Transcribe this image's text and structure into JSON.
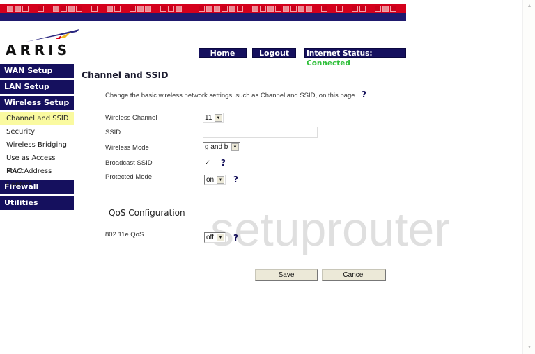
{
  "brand": {
    "logo_text": "ARRIS"
  },
  "topnav": {
    "home": "Home",
    "logout": "Logout",
    "status_label": "Internet Status:",
    "status_value": "Connected"
  },
  "sidebar": {
    "sections": [
      {
        "label": "WAN Setup"
      },
      {
        "label": "LAN Setup"
      },
      {
        "label": "Wireless Setup"
      }
    ],
    "wireless_items": [
      {
        "label": "Channel and SSID",
        "active": true
      },
      {
        "label": "Security"
      },
      {
        "label": "Wireless Bridging"
      },
      {
        "label": "Use as Access Point"
      },
      {
        "label": "MAC Address Control"
      }
    ],
    "bottom_sections": [
      {
        "label": "Firewall"
      },
      {
        "label": "Utilities"
      }
    ]
  },
  "main": {
    "title": "Channel and SSID",
    "description": "Change the basic wireless network settings, such as Channel and SSID, on this page.",
    "help_glyph": "?",
    "fields": {
      "channel": {
        "label": "Wireless Channel",
        "value": "11"
      },
      "ssid": {
        "label": "SSID",
        "value": ""
      },
      "mode": {
        "label": "Wireless Mode",
        "value": "g and b"
      },
      "broadcast": {
        "label": "Broadcast SSID",
        "checked": true,
        "glyph": "✓"
      },
      "protected": {
        "label": "Protected Mode",
        "value": "on"
      }
    },
    "qos": {
      "title": "QoS Configuration",
      "label": "802.11e QoS",
      "value": "off"
    },
    "buttons": {
      "save": "Save",
      "cancel": "Cancel"
    }
  },
  "watermark": "setuprouter",
  "colors": {
    "nav_bg": "#15105e",
    "banner_red": "#d4001c",
    "active_item": "#fafaa0",
    "status_green": "#2fbf3a"
  }
}
